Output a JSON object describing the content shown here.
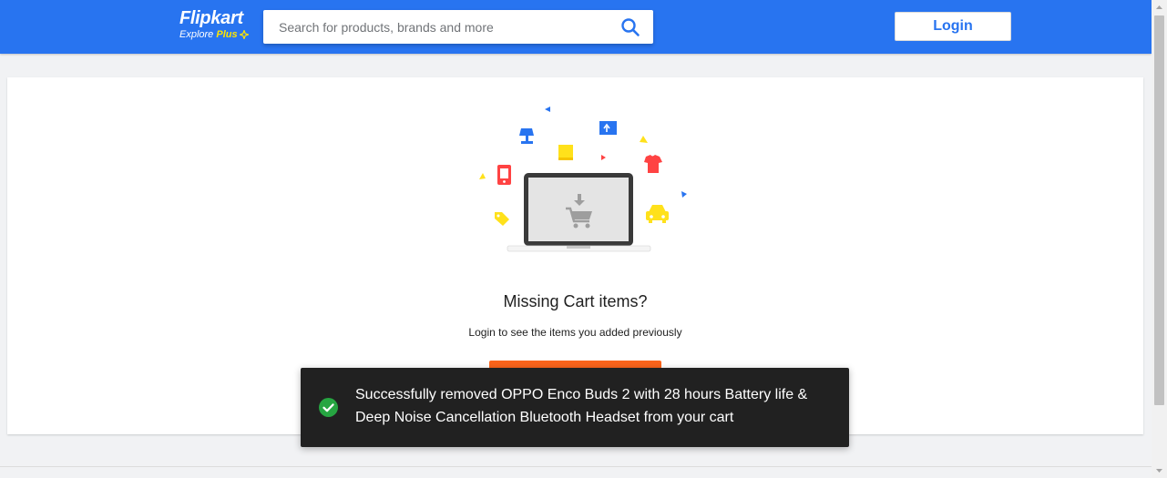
{
  "header": {
    "logo_text": "Flipkart",
    "logo_sub_explore": "Explore",
    "logo_sub_plus": "Plus",
    "search": {
      "placeholder": "Search for products, brands and more",
      "value": ""
    },
    "search_icon": "search-icon",
    "login_label": "Login"
  },
  "empty_cart": {
    "title": "Missing Cart items?",
    "subtitle": "Login to see the items you added previously",
    "illustration_icons": [
      "laptop-icon",
      "cart-icon",
      "lamp-icon",
      "mobile-icon",
      "book-icon",
      "monitor-icon",
      "tshirt-icon",
      "tag-icon",
      "car-icon"
    ]
  },
  "toast": {
    "message": "Successfully removed OPPO Enco Buds 2 with 28 hours Battery life & Deep Noise Cancellation Bluetooth Headset from your cart",
    "icon": "check-circle-icon"
  },
  "colors": {
    "brand_blue": "#2874f0",
    "brand_yellow": "#ffe500",
    "cta_orange": "#fb641b",
    "toast_bg": "#212121",
    "success_green": "#26a541"
  }
}
